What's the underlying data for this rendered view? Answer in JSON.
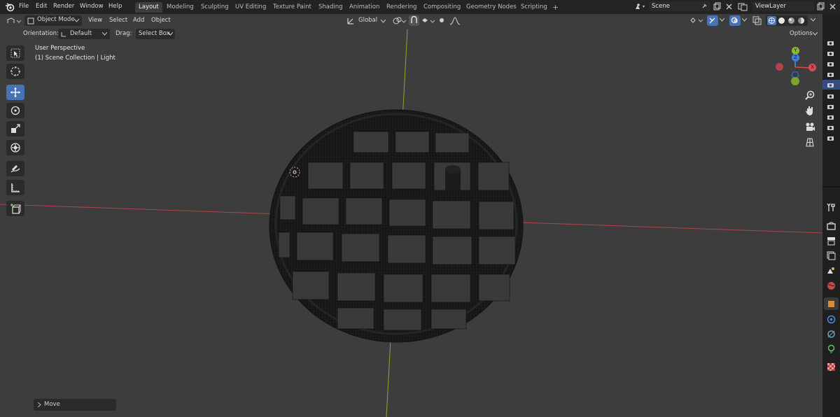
{
  "menus": [
    "File",
    "Edit",
    "Render",
    "Window",
    "Help"
  ],
  "workspace_tabs": [
    "Layout",
    "Modeling",
    "Sculpting",
    "UV Editing",
    "Texture Paint",
    "Shading",
    "Animation",
    "Rendering",
    "Compositing",
    "Geometry Nodes",
    "Scripting"
  ],
  "add_tab_label": "+",
  "scene": {
    "label": "Scene"
  },
  "view_layer": {
    "label": "ViewLayer"
  },
  "header": {
    "mode": "Object Mode",
    "menus": [
      "View",
      "Select",
      "Add",
      "Object"
    ],
    "transform_orientation": "Global",
    "options": "Options"
  },
  "tool_settings": {
    "orientation_label": "Orientation:",
    "orientation_value": "Default",
    "drag_label": "Drag:",
    "drag_value": "Select Box"
  },
  "viewport": {
    "perspective": "User Perspective",
    "collection": "(1) Scene Collection | Light"
  },
  "last_operation": {
    "label": "Move"
  },
  "toolbar": [
    {
      "name": "select-box-tool",
      "icon": "cursor-arrow-icon",
      "active": false
    },
    {
      "name": "cursor-tool",
      "icon": "crosshair-icon",
      "active": false
    },
    {
      "name": "move-tool",
      "icon": "move-arrows-icon",
      "active": true
    },
    {
      "name": "rotate-tool",
      "icon": "rotate-icon",
      "active": false
    },
    {
      "name": "scale-tool",
      "icon": "scale-icon",
      "active": false
    },
    {
      "name": "transform-tool",
      "icon": "transform-icon",
      "active": false
    },
    {
      "name": "annotate-tool",
      "icon": "pencil-icon",
      "active": false
    },
    {
      "name": "measure-tool",
      "icon": "ruler-icon",
      "active": false
    },
    {
      "name": "add-cube-tool",
      "icon": "cube-add-icon",
      "active": false
    }
  ],
  "gizmo": {
    "x": "X",
    "y": "Y",
    "z": "Z"
  },
  "colors": {
    "accent": "#4772b3",
    "x_axis": "#d94c55",
    "y_axis": "#8bb82e",
    "z_axis": "#3f7fd9",
    "viewport_bg": "#3d3d3d"
  }
}
